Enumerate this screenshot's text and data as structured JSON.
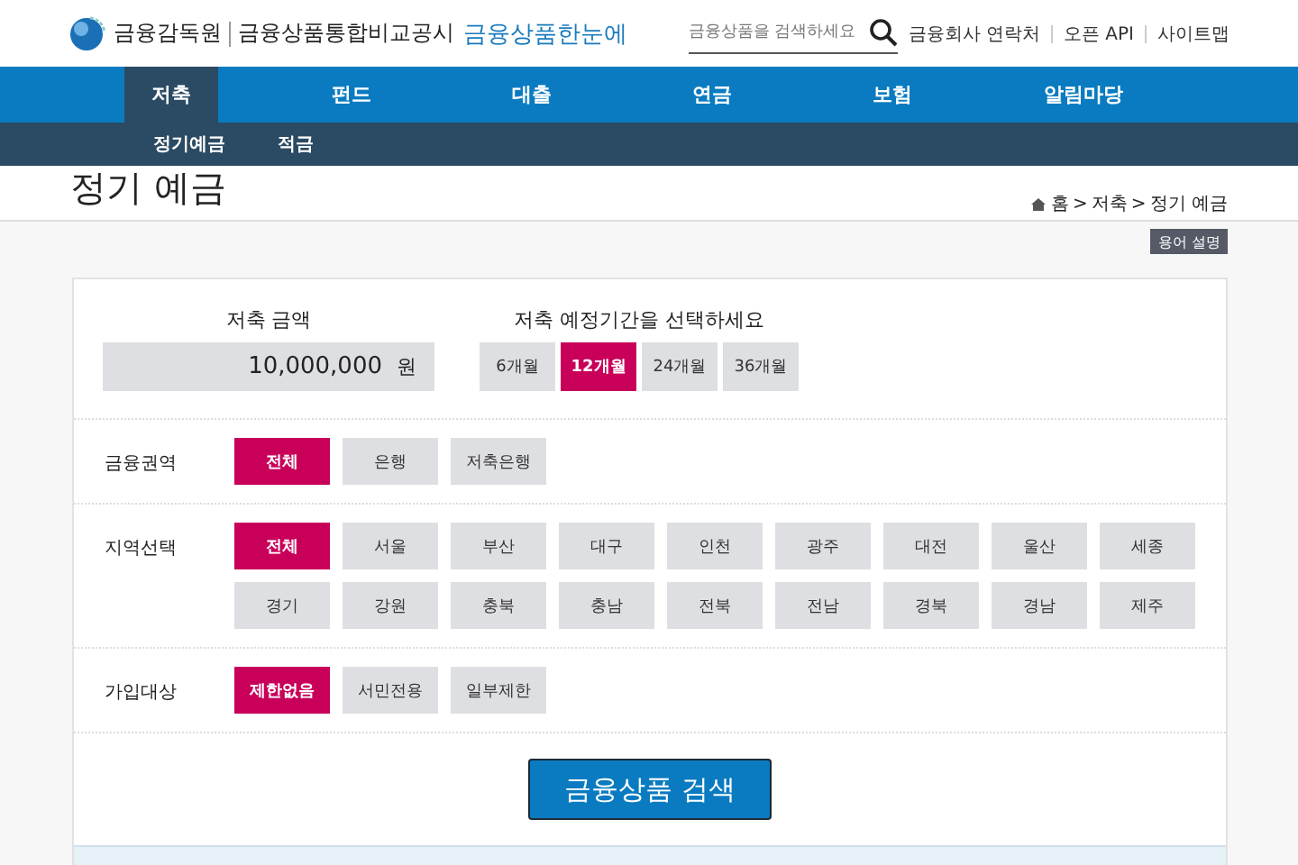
{
  "header": {
    "org": "금융감독원",
    "site_name": "금융상품통합비교공시",
    "brand": "금융상품한눈에",
    "search": {
      "placeholder": "금융상품을 검색하세요"
    },
    "links": [
      "금융회사 연락처",
      "오픈 API",
      "사이트맵"
    ]
  },
  "nav": [
    {
      "label": "저축",
      "selected": true
    },
    {
      "label": "펀드",
      "selected": false
    },
    {
      "label": "대출",
      "selected": false
    },
    {
      "label": "연금",
      "selected": false
    },
    {
      "label": "보험",
      "selected": false
    },
    {
      "label": "알림마당",
      "selected": false
    }
  ],
  "subnav": [
    "정기예금",
    "적금"
  ],
  "page_title": "정기 예금",
  "breadcrumb": {
    "items": [
      "홈",
      "저축",
      "정기 예금"
    ],
    "separator": ">"
  },
  "glossary_button": "용어 설명",
  "amount": {
    "label": "저축 금액",
    "value": "10,000,000",
    "unit": "원"
  },
  "period": {
    "label": "저축 예정기간을 선택하세요",
    "options": [
      {
        "label": "6개월",
        "selected": false
      },
      {
        "label": "12개월",
        "selected": true
      },
      {
        "label": "24개월",
        "selected": false
      },
      {
        "label": "36개월",
        "selected": false
      }
    ]
  },
  "filters": [
    {
      "label": "금융권역",
      "options": [
        {
          "label": "전체",
          "selected": true
        },
        {
          "label": "은행",
          "selected": false
        },
        {
          "label": "저축은행",
          "selected": false
        }
      ]
    },
    {
      "label": "지역선택",
      "options": [
        {
          "label": "전체",
          "selected": true
        },
        {
          "label": "서울",
          "selected": false
        },
        {
          "label": "부산",
          "selected": false
        },
        {
          "label": "대구",
          "selected": false
        },
        {
          "label": "인천",
          "selected": false
        },
        {
          "label": "광주",
          "selected": false
        },
        {
          "label": "대전",
          "selected": false
        },
        {
          "label": "울산",
          "selected": false
        },
        {
          "label": "세종",
          "selected": false
        },
        {
          "label": "경기",
          "selected": false
        },
        {
          "label": "강원",
          "selected": false
        },
        {
          "label": "충북",
          "selected": false
        },
        {
          "label": "충남",
          "selected": false
        },
        {
          "label": "전북",
          "selected": false
        },
        {
          "label": "전남",
          "selected": false
        },
        {
          "label": "경북",
          "selected": false
        },
        {
          "label": "경남",
          "selected": false
        },
        {
          "label": "제주",
          "selected": false
        }
      ]
    },
    {
      "label": "가입대상",
      "options": [
        {
          "label": "제한없음",
          "selected": true
        },
        {
          "label": "서민전용",
          "selected": false
        },
        {
          "label": "일부제한",
          "selected": false
        }
      ]
    }
  ],
  "search_button": "금융상품 검색"
}
